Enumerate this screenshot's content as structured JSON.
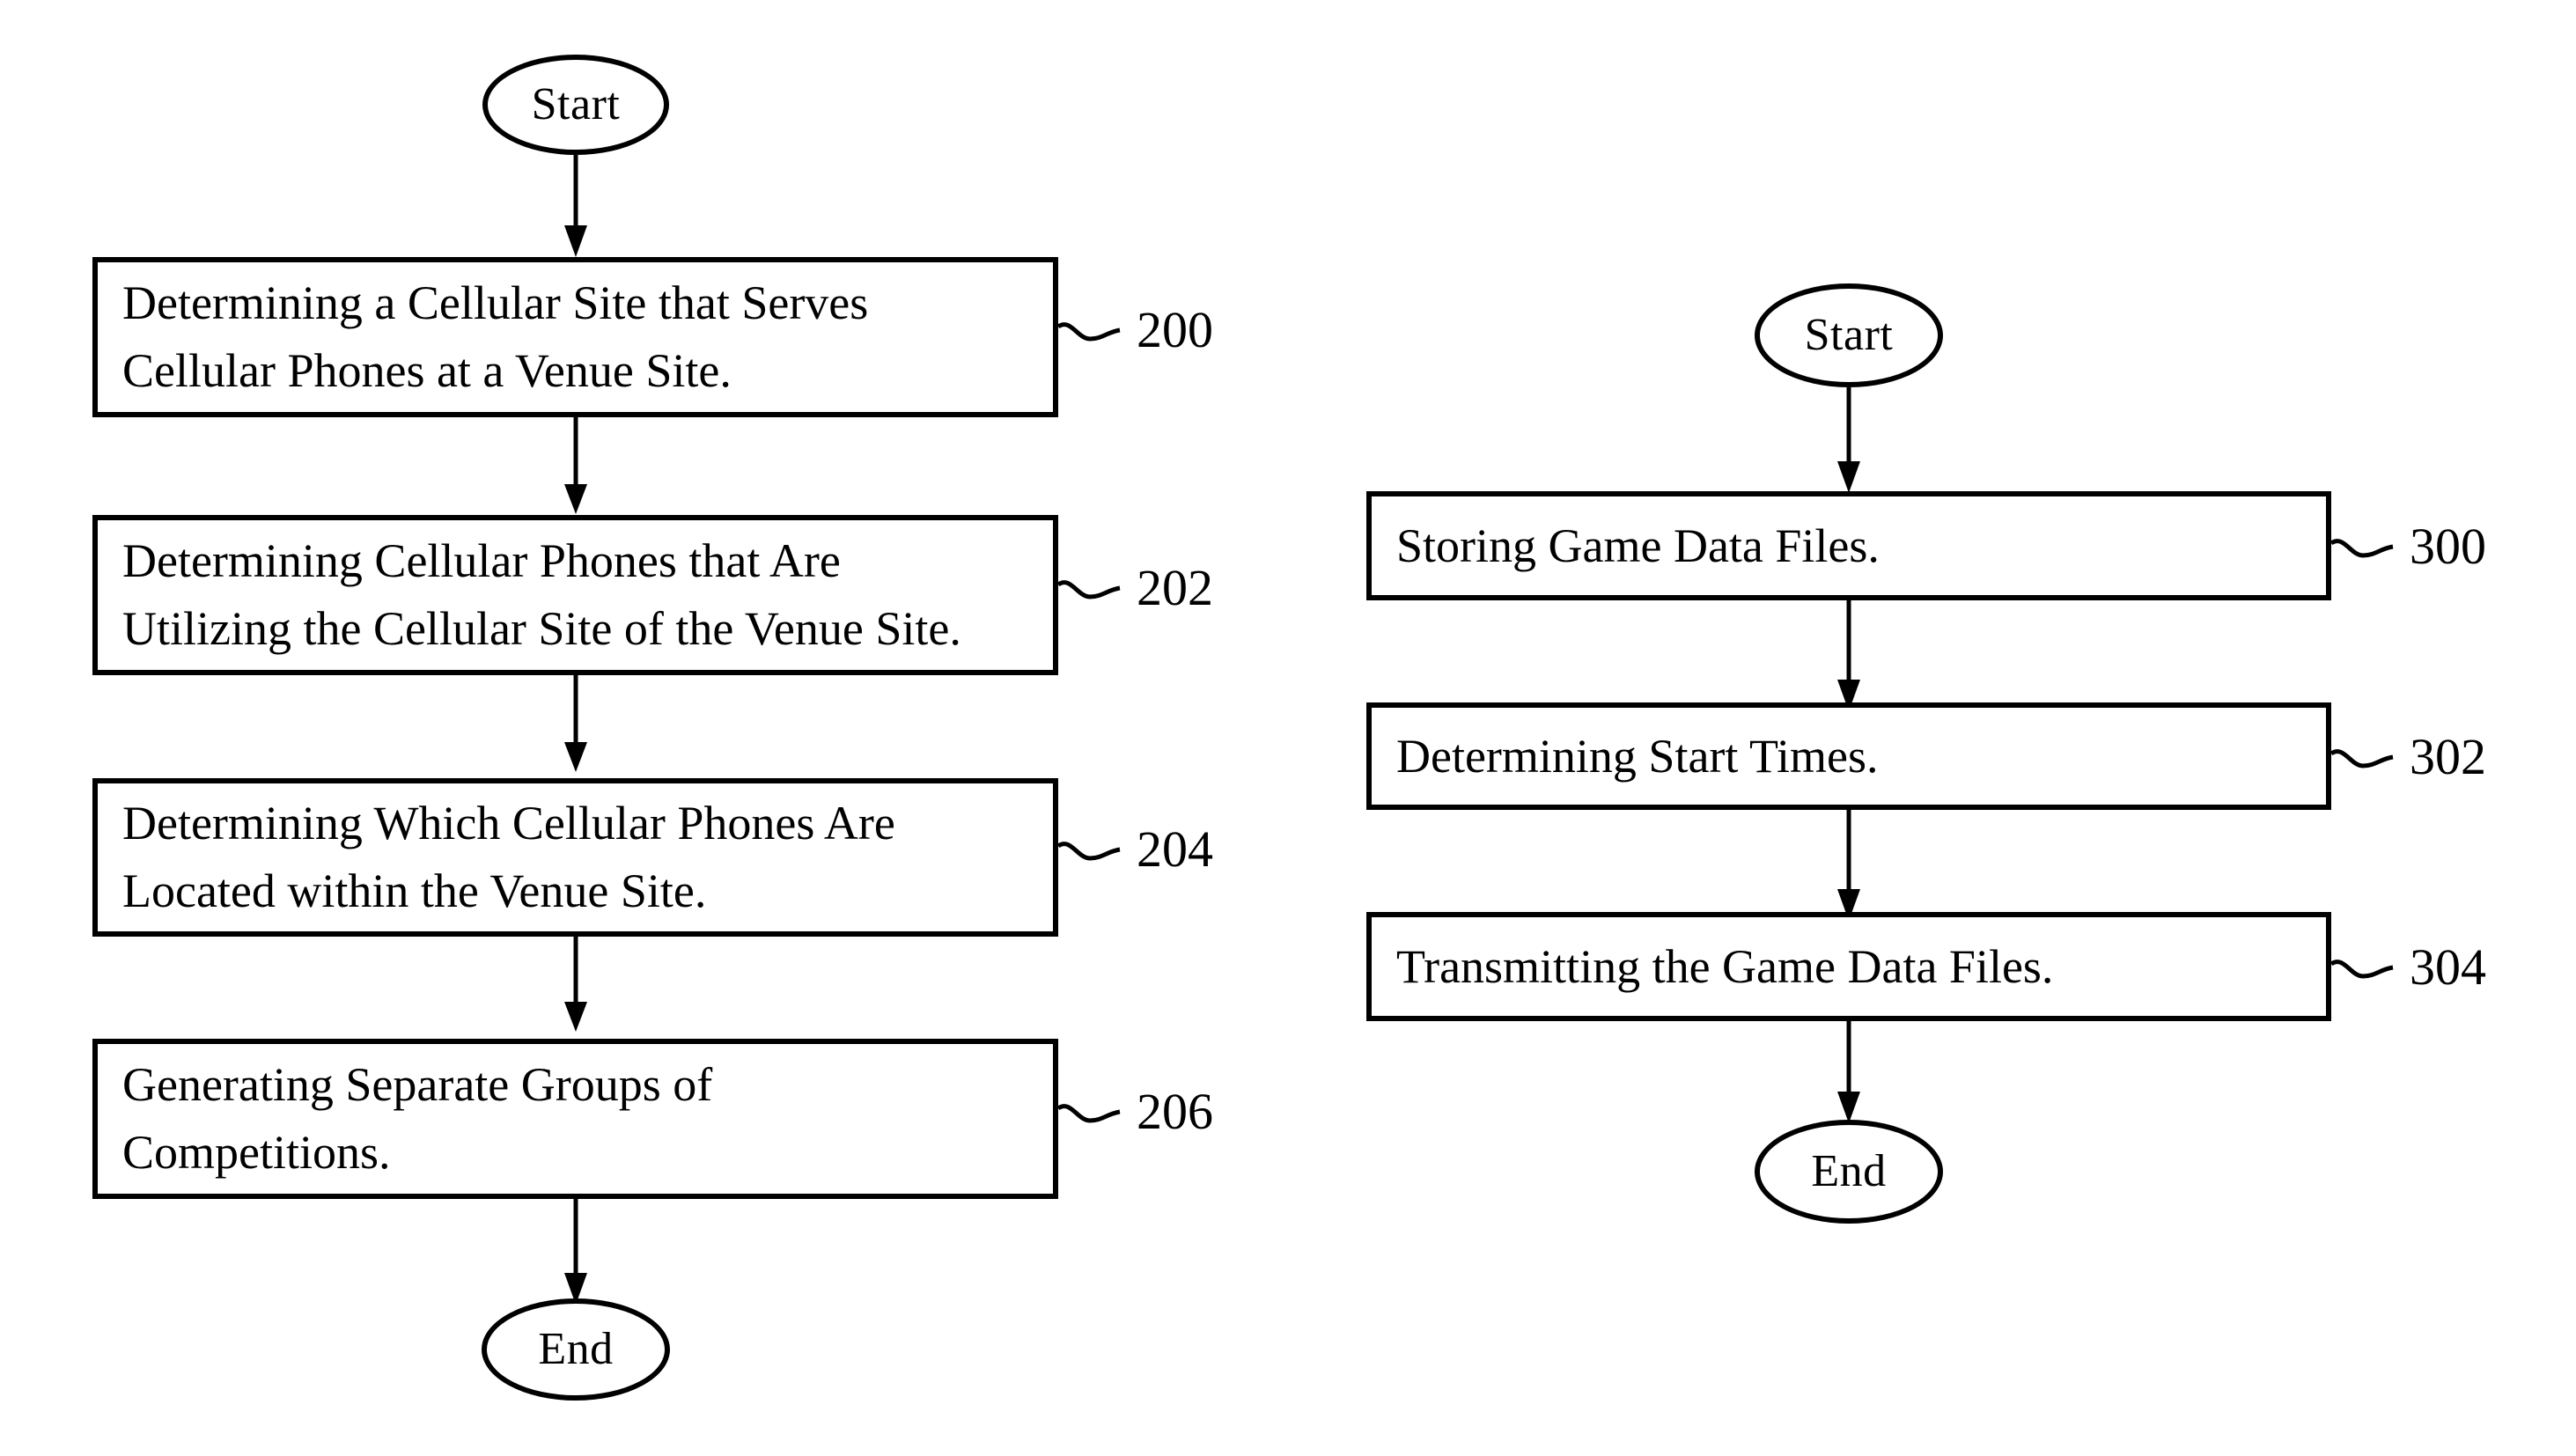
{
  "figure": {
    "background_color": "#ffffff",
    "line_color": "#000000",
    "flowcharts": [
      {
        "id": "flowchart-left",
        "start_label": "Start",
        "end_label": "End",
        "steps": [
          {
            "text": "Determining a Cellular Site that Serves\nCellular Phones at a Venue Site.",
            "ref": "200"
          },
          {
            "text": "Determining Cellular Phones that Are\nUtilizing the Cellular Site of the Venue Site.",
            "ref": "202"
          },
          {
            "text": "Determining Which Cellular Phones Are\nLocated within the Venue Site.",
            "ref": "204"
          },
          {
            "text": "Generating Separate Groups of\nCompetitions.",
            "ref": "206"
          }
        ]
      },
      {
        "id": "flowchart-right",
        "start_label": "Start",
        "end_label": "End",
        "steps": [
          {
            "text": "Storing Game Data Files.",
            "ref": "300"
          },
          {
            "text": "Determining Start Times.",
            "ref": "302"
          },
          {
            "text": "Transmitting the Game Data Files.",
            "ref": "304"
          }
        ]
      }
    ]
  }
}
